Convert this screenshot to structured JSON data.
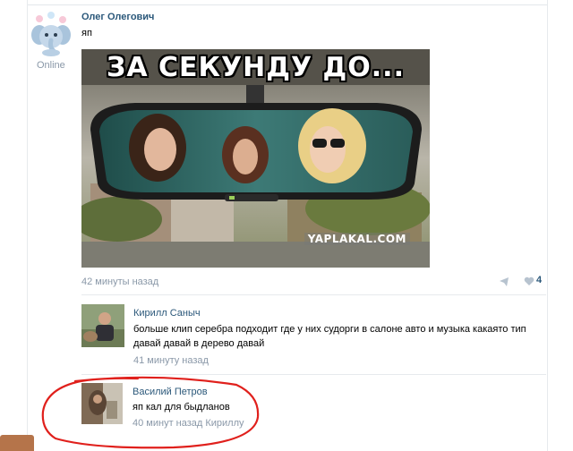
{
  "post": {
    "author": "Олег Олегович",
    "status": "Online",
    "text": "яп",
    "image": {
      "caption": "ЗА СЕКУНДУ ДО...",
      "watermark": "YAPLAKAL.COM"
    },
    "time": "42 минуты назад",
    "likes": "4"
  },
  "comments": [
    {
      "name": "Кирилл Саныч",
      "text": "больше клип серебра подходит где у них судорги в салоне авто и музыка какаято тип давай давай в дерево давай",
      "time": "41 минуту назад"
    },
    {
      "name": "Василий Петров",
      "text": "яп кал для быдланов",
      "time": "40 минут назад Кириллу"
    }
  ],
  "colors": {
    "link": "#2b587a",
    "meta": "#8a98a8",
    "annotation": "#e0201c"
  },
  "icons": [
    "elephant-avatar",
    "share-icon",
    "heart-icon"
  ]
}
